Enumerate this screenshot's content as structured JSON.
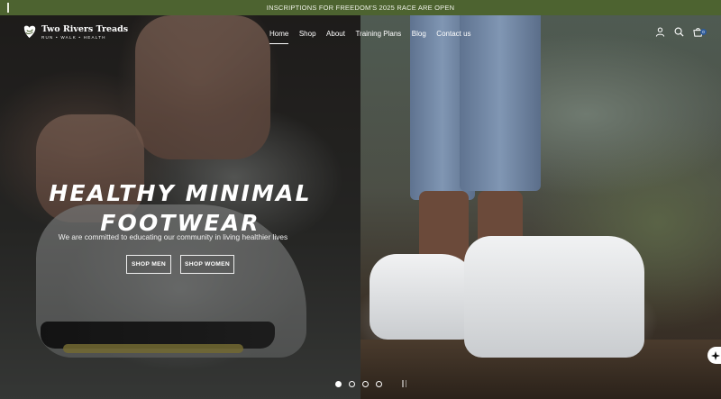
{
  "announcement": {
    "text": "INSCRIPTIONS FOR FREEDOM'S 2025 RACE ARE OPEN"
  },
  "logo": {
    "name": "Two Rivers Treads",
    "tagline": "RUN • WALK • HEALTH"
  },
  "nav": {
    "items": [
      {
        "label": "Home",
        "active": true
      },
      {
        "label": "Shop",
        "active": false
      },
      {
        "label": "About",
        "active": false
      },
      {
        "label": "Training Plans",
        "active": false
      },
      {
        "label": "Blog",
        "active": false
      },
      {
        "label": "Contact us",
        "active": false
      }
    ]
  },
  "header_icons": {
    "account": "user-icon",
    "search": "search-icon",
    "cart": "cart-icon",
    "cart_count": "0"
  },
  "hero": {
    "title_line1": "HEALTHY MINIMAL",
    "title_line2": "FOOTWEAR",
    "subtitle": "We are committed to educating our community in living healthier lives",
    "buttons": {
      "men": "SHOP MEN",
      "women": "SHOP WOMEN"
    }
  },
  "slider": {
    "count": 4,
    "active_index": 0
  },
  "colors": {
    "announcement_bg": "#4d6330",
    "cart_badge": "#2d5a9a"
  }
}
